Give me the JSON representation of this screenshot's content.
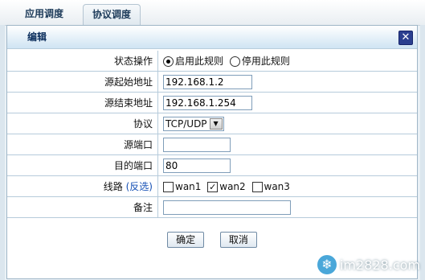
{
  "tabs": [
    {
      "label": "应用调度"
    },
    {
      "label": "协议调度"
    }
  ],
  "dialog": {
    "title": "编辑",
    "close_icon": "close-icon"
  },
  "form": {
    "status_op": {
      "label": "状态操作",
      "options": [
        "启用此规则",
        "停用此规则"
      ],
      "selected": "启用此规则"
    },
    "src_start": {
      "label": "源起始地址",
      "value": "192.168.1.2"
    },
    "src_end": {
      "label": "源结束地址",
      "value": "192.168.1.254"
    },
    "protocol": {
      "label": "协议",
      "value": "TCP/UDP"
    },
    "src_port": {
      "label": "源端口",
      "value": ""
    },
    "dst_port": {
      "label": "目的端口",
      "value": "80"
    },
    "line": {
      "label": "线路",
      "invert_link": "(反选)",
      "options": [
        {
          "label": "wan1",
          "checked": false
        },
        {
          "label": "wan2",
          "checked": true
        },
        {
          "label": "wan3",
          "checked": false
        }
      ]
    },
    "note": {
      "label": "备注",
      "value": ""
    }
  },
  "buttons": {
    "ok": "确定",
    "cancel": "取消"
  },
  "watermark": {
    "text": "im2828.com"
  }
}
